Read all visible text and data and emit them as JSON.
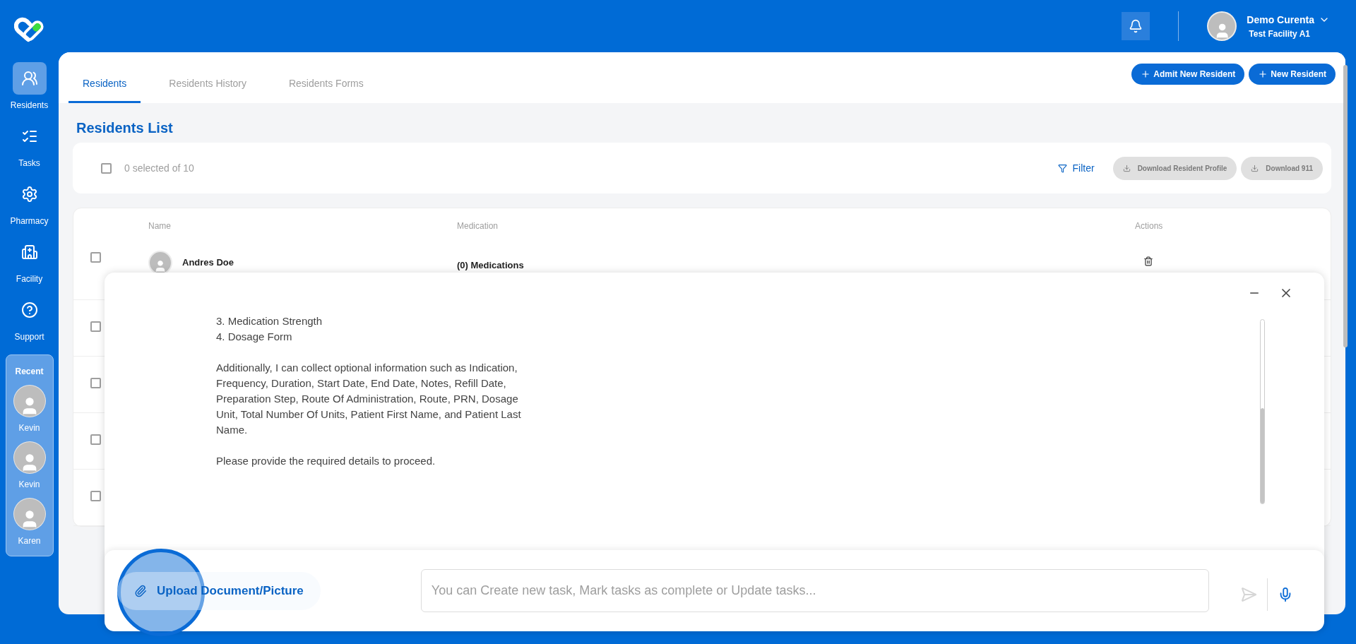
{
  "header": {
    "user_name": "Demo Curenta",
    "facility": "Test Facility A1"
  },
  "sidebar": {
    "items": [
      {
        "kind": "residents",
        "label": "Residents",
        "selected": true
      },
      {
        "kind": "tasks",
        "label": "Tasks",
        "selected": false
      },
      {
        "kind": "pharmacy",
        "label": "Pharmacy",
        "selected": false
      },
      {
        "kind": "facility",
        "label": "Facility",
        "selected": false
      },
      {
        "kind": "support",
        "label": "Support",
        "selected": false
      }
    ],
    "recent": {
      "title": "Recent",
      "people": [
        "Kevin",
        "Kevin",
        "Karen"
      ]
    }
  },
  "tabs": [
    {
      "label": "Residents",
      "selected": true
    },
    {
      "label": "Residents History",
      "selected": false
    },
    {
      "label": "Residents Forms",
      "selected": false
    }
  ],
  "header_buttons": [
    "Admit New Resident",
    "New Resident"
  ],
  "list_title": "Residents List",
  "toolbar": {
    "select_all_checked": false,
    "selection": "0 selected of 10",
    "filter": "Filter",
    "downloads": [
      {
        "label": "Download Resident Profile",
        "disabled": true
      },
      {
        "label": "Download 911",
        "disabled": true
      }
    ]
  },
  "table": {
    "columns": [
      "Name",
      "Medication",
      "Actions"
    ],
    "rows": [
      {
        "name": "Andres Doe",
        "medication": "(0) Medications",
        "checked": false
      },
      {
        "checked": false
      },
      {
        "checked": false
      },
      {
        "checked": false
      },
      {
        "checked": false
      }
    ]
  },
  "chat": {
    "message_lines": [
      "3. Medication Strength",
      "4. Dosage Form"
    ],
    "paragraphs": [
      "Additionally, I can collect optional information such as Indication, Frequency, Duration, Start Date, End Date, Notes, Refill Date, Preparation Step, Route Of Administration, Route, PRN, Dosage Unit, Total Number Of Units, Patient First Name, and Patient Last Name.",
      "Please provide the required details to proceed."
    ],
    "upload": "Upload Document/Picture",
    "input_placeholder": "You can Create new task, Mark tasks as complete or Update tasks...",
    "highlight": true
  }
}
